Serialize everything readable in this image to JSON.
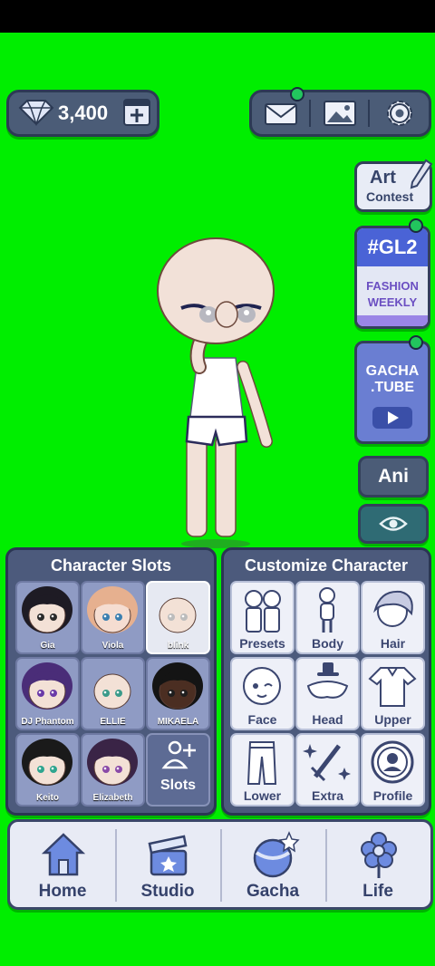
{
  "currency": {
    "gems": "3,400",
    "icon": "diamond-icon"
  },
  "top_actions": [
    {
      "name": "mail",
      "icon": "mail-icon",
      "notification": true
    },
    {
      "name": "gallery",
      "icon": "image-icon",
      "notification": false
    },
    {
      "name": "settings",
      "icon": "gear-icon",
      "notification": false
    }
  ],
  "side": {
    "art_contest": {
      "line1": "Art",
      "line2": "Contest"
    },
    "gl2": {
      "title": "#GL2",
      "line1": "FASHION",
      "line2": "WEEKLY"
    },
    "gachatube": {
      "line1": "GACHA",
      "line2": ".TUBE"
    },
    "ani": "Ani"
  },
  "character_slots": {
    "title": "Character Slots",
    "slots": [
      {
        "name": "Gia",
        "hair": "#1e1b24",
        "skin": "#f3e1d6",
        "eyes": "#2a2a2a"
      },
      {
        "name": "Viola",
        "hair": "#e6b08f",
        "skin": "#f5ddd1",
        "eyes": "#3a7fb0"
      },
      {
        "name": "blink",
        "hair": "none",
        "skin": "#f3e1d6",
        "eyes": "#bcbcbc"
      },
      {
        "name": "DJ Phantom",
        "hair": "#4a2d78",
        "skin": "#f3e1d6",
        "eyes": "#6a3aa8"
      },
      {
        "name": "ELLIE",
        "hair": "none",
        "skin": "#f3e1d6",
        "eyes": "#3a9a8a"
      },
      {
        "name": "MIKAELA",
        "hair": "#141414",
        "skin": "#4b2e22",
        "eyes": "#1e1e1e"
      },
      {
        "name": "Keito",
        "hair": "#1a1a1a",
        "skin": "#f3e1d6",
        "eyes": "#2fa58f"
      },
      {
        "name": "Elizabeth",
        "hair": "#3a2446",
        "skin": "#f3e1d6",
        "eyes": "#8a4aa8"
      }
    ],
    "add_slots": "Slots"
  },
  "customize": {
    "title": "Customize Character",
    "items": [
      "Presets",
      "Body",
      "Hair",
      "Face",
      "Head",
      "Upper",
      "Lower",
      "Extra",
      "Profile"
    ]
  },
  "nav": [
    "Home",
    "Studio",
    "Gacha",
    "Life"
  ]
}
